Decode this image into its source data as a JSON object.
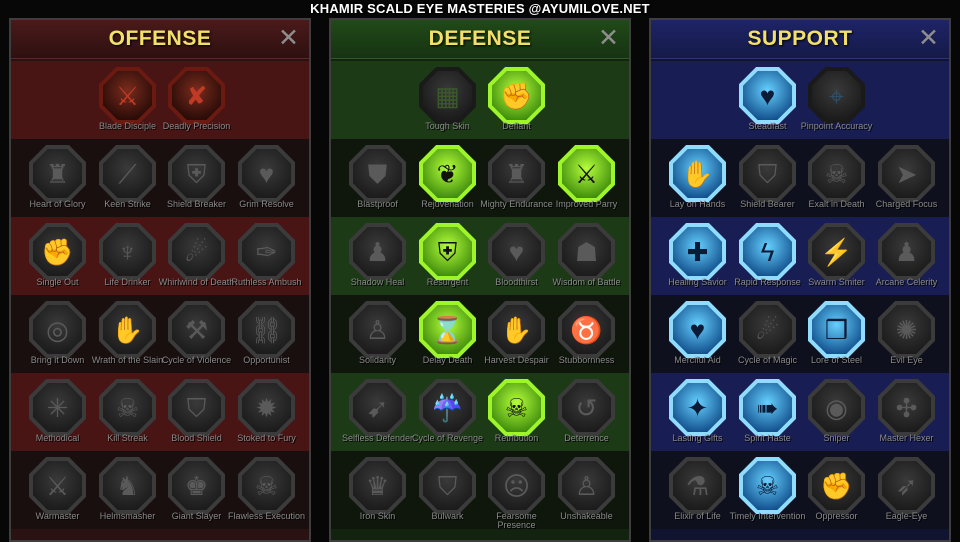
{
  "banner": "KHAMIR SCALD EYE MASTERIES @AYUMILOVE.NET",
  "close_glyph": "✕",
  "trees": {
    "offense": {
      "title": "OFFENSE",
      "tiers": [
        [
          {
            "label": "Blade Disciple",
            "icon": "crossed-swords-icon",
            "glyph": "⚔",
            "state": "on-red"
          },
          {
            "label": "Deadly Precision",
            "icon": "daggers-icon",
            "glyph": "✘",
            "state": "on-red"
          }
        ],
        [
          {
            "label": "Heart of Glory",
            "icon": "horned-helm-icon",
            "glyph": "♜",
            "state": "off"
          },
          {
            "label": "Keen Strike",
            "icon": "slash-icon",
            "glyph": "⟋",
            "state": "off"
          },
          {
            "label": "Shield Breaker",
            "icon": "broken-shield-icon",
            "glyph": "⛨",
            "state": "off"
          },
          {
            "label": "Grim Resolve",
            "icon": "heart-hands-icon",
            "glyph": "♥",
            "state": "off"
          }
        ],
        [
          {
            "label": "Single Out",
            "icon": "fist-icon",
            "glyph": "✊",
            "state": "off"
          },
          {
            "label": "Life Drinker",
            "icon": "fangs-icon",
            "glyph": "♆",
            "state": "off"
          },
          {
            "label": "Whirlwind of Death",
            "icon": "whirlwind-icon",
            "glyph": "☄",
            "state": "off"
          },
          {
            "label": "Ruthless Ambush",
            "icon": "stab-icon",
            "glyph": "✑",
            "state": "off"
          }
        ],
        [
          {
            "label": "Bring it Down",
            "icon": "target-icon",
            "glyph": "◎",
            "state": "off"
          },
          {
            "label": "Wrath of the Slain",
            "icon": "raised-fist-icon",
            "glyph": "✋",
            "state": "off"
          },
          {
            "label": "Cycle of Violence",
            "icon": "axe-icon",
            "glyph": "⚒",
            "state": "off"
          },
          {
            "label": "Opportunist",
            "icon": "chains-icon",
            "glyph": "⛓",
            "state": "off"
          }
        ],
        [
          {
            "label": "Methodical",
            "icon": "spider-icon",
            "glyph": "✳",
            "state": "off"
          },
          {
            "label": "Kill Streak",
            "icon": "skull-icon",
            "glyph": "☠",
            "state": "off"
          },
          {
            "label": "Blood Shield",
            "icon": "sword-shield-icon",
            "glyph": "⛉",
            "state": "off"
          },
          {
            "label": "Stoked to Fury",
            "icon": "burst-icon",
            "glyph": "✹",
            "state": "off"
          }
        ],
        [
          {
            "label": "Warmaster",
            "icon": "sword-strike-icon",
            "glyph": "⚔",
            "state": "off"
          },
          {
            "label": "Helmsmasher",
            "icon": "helmet-icon",
            "glyph": "♞",
            "state": "off"
          },
          {
            "label": "Giant Slayer",
            "icon": "giant-icon",
            "glyph": "♚",
            "state": "off"
          },
          {
            "label": "Flawless Execution",
            "icon": "skull-blade-icon",
            "glyph": "☠",
            "state": "off"
          }
        ]
      ]
    },
    "defense": {
      "title": "DEFENSE",
      "tiers": [
        [
          {
            "label": "Tough Skin",
            "icon": "scales-icon",
            "glyph": "▦",
            "state": "dim-green"
          },
          {
            "label": "Defiant",
            "icon": "raised-fist-icon",
            "glyph": "✊",
            "state": "on-green"
          }
        ],
        [
          {
            "label": "Blastproof",
            "icon": "chevron-shield-icon",
            "glyph": "⛊",
            "state": "off"
          },
          {
            "label": "Rejuvenation",
            "icon": "heart-hand-icon",
            "glyph": "❦",
            "state": "on-green"
          },
          {
            "label": "Mighty Endurance",
            "icon": "muscle-icon",
            "glyph": "♜",
            "state": "off"
          },
          {
            "label": "Improved Parry",
            "icon": "parry-swords-icon",
            "glyph": "⚔",
            "state": "on-green"
          }
        ],
        [
          {
            "label": "Shadow Heal",
            "icon": "shadow-figure-icon",
            "glyph": "♟",
            "state": "off"
          },
          {
            "label": "Resurgent",
            "icon": "knight-shield-icon",
            "glyph": "⛨",
            "state": "on-green"
          },
          {
            "label": "Bloodthirst",
            "icon": "heart-skull-icon",
            "glyph": "♥",
            "state": "off"
          },
          {
            "label": "Wisdom of Battle",
            "icon": "hooded-head-icon",
            "glyph": "☗",
            "state": "off"
          }
        ],
        [
          {
            "label": "Solidarity",
            "icon": "group-icon",
            "glyph": "♙",
            "state": "off"
          },
          {
            "label": "Delay Death",
            "icon": "hourglass-icon",
            "glyph": "⌛",
            "state": "on-green"
          },
          {
            "label": "Harvest Despair",
            "icon": "hand-icon",
            "glyph": "✋",
            "state": "off"
          },
          {
            "label": "Stubbornness",
            "icon": "bull-icon",
            "glyph": "♉",
            "state": "off"
          }
        ],
        [
          {
            "label": "Selfless Defender",
            "icon": "runner-icon",
            "glyph": "➹",
            "state": "off"
          },
          {
            "label": "Cycle of Revenge",
            "icon": "drops-icon",
            "glyph": "☔",
            "state": "off"
          },
          {
            "label": "Retribution",
            "icon": "glowing-skull-icon",
            "glyph": "☠",
            "state": "on-green"
          },
          {
            "label": "Deterrence",
            "icon": "deflect-icon",
            "glyph": "↺",
            "state": "off"
          }
        ],
        [
          {
            "label": "Iron Skin",
            "icon": "armored-head-icon",
            "glyph": "♛",
            "state": "off"
          },
          {
            "label": "Bulwark",
            "icon": "tower-shield-icon",
            "glyph": "⛉",
            "state": "off"
          },
          {
            "label": "Fearsome Presence",
            "icon": "fearsome-face-icon",
            "glyph": "☹",
            "state": "off"
          },
          {
            "label": "Unshakeable",
            "icon": "statue-icon",
            "glyph": "♙",
            "state": "off"
          }
        ]
      ]
    },
    "support": {
      "title": "SUPPORT",
      "tiers": [
        [
          {
            "label": "Steadfast",
            "icon": "heart-hands-icon",
            "glyph": "♥",
            "state": "on-blue"
          },
          {
            "label": "Pinpoint Accuracy",
            "icon": "crosshair-icon",
            "glyph": "⌖",
            "state": "dim-blue"
          }
        ],
        [
          {
            "label": "Lay on Hands",
            "icon": "praying-hands-icon",
            "glyph": "✋",
            "state": "on-blue"
          },
          {
            "label": "Shield Bearer",
            "icon": "shield-icon",
            "glyph": "⛉",
            "state": "off"
          },
          {
            "label": "Exalt in Death",
            "icon": "skull-icon",
            "glyph": "☠",
            "state": "off"
          },
          {
            "label": "Charged Focus",
            "icon": "charged-hand-icon",
            "glyph": "➤",
            "state": "off"
          }
        ],
        [
          {
            "label": "Healing Savior",
            "icon": "healer-icon",
            "glyph": "✚",
            "state": "on-blue"
          },
          {
            "label": "Rapid Response",
            "icon": "lightning-icon",
            "glyph": "ϟ",
            "state": "on-blue"
          },
          {
            "label": "Swarm Smiter",
            "icon": "swarm-icon",
            "glyph": "⚡",
            "state": "off"
          },
          {
            "label": "Arcane Celerity",
            "icon": "fleeing-figure-icon",
            "glyph": "♟",
            "state": "off"
          }
        ],
        [
          {
            "label": "Merciful Aid",
            "icon": "chained-heart-icon",
            "glyph": "♥",
            "state": "on-blue"
          },
          {
            "label": "Cycle of Magic",
            "icon": "comet-icon",
            "glyph": "☄",
            "state": "off"
          },
          {
            "label": "Lore of Steel",
            "icon": "open-book-icon",
            "glyph": "❒",
            "state": "on-blue"
          },
          {
            "label": "Evil Eye",
            "icon": "eye-rays-icon",
            "glyph": "✺",
            "state": "off"
          }
        ],
        [
          {
            "label": "Lasting Gifts",
            "icon": "star-icon",
            "glyph": "✦",
            "state": "on-blue"
          },
          {
            "label": "Spirit Haste",
            "icon": "winged-boot-icon",
            "glyph": "➠",
            "state": "on-blue"
          },
          {
            "label": "Sniper",
            "icon": "eye-icon",
            "glyph": "◉",
            "state": "off"
          },
          {
            "label": "Master Hexer",
            "icon": "hexer-icon",
            "glyph": "✣",
            "state": "off"
          }
        ],
        [
          {
            "label": "Elixir of Life",
            "icon": "potion-icon",
            "glyph": "⚗",
            "state": "off"
          },
          {
            "label": "Timely Intervention",
            "icon": "skull-icon",
            "glyph": "☠",
            "state": "on-blue"
          },
          {
            "label": "Oppressor",
            "icon": "crushing-fist-icon",
            "glyph": "✊",
            "state": "off"
          },
          {
            "label": "Eagle-Eye",
            "icon": "eagle-icon",
            "glyph": "➶",
            "state": "off"
          }
        ]
      ]
    }
  }
}
